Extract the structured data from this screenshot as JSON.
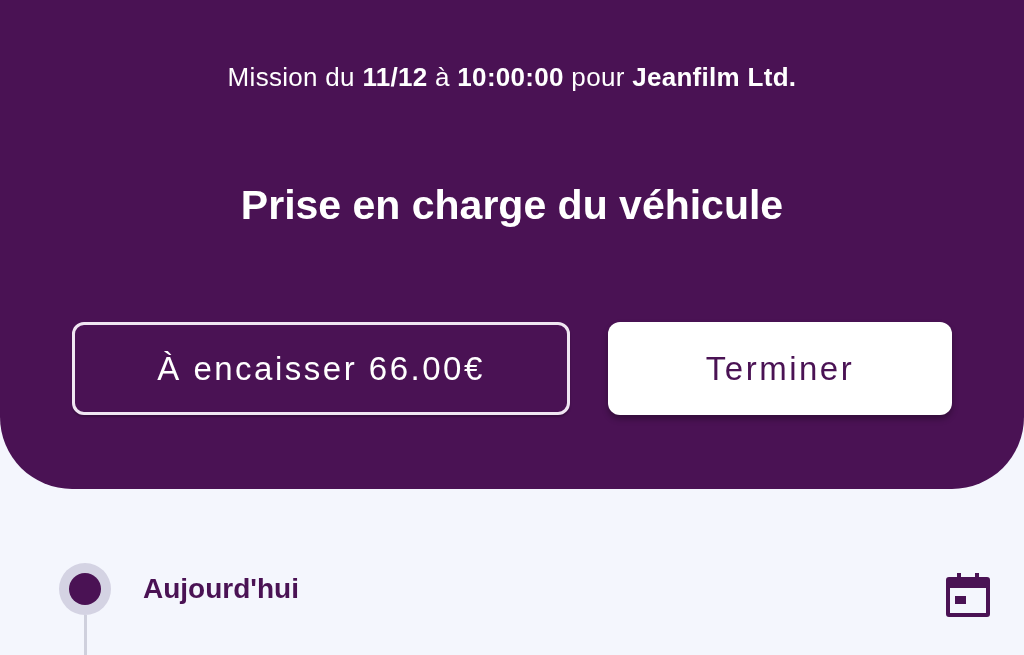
{
  "header": {
    "mission_line": "Mission du **11/12** à **10:00:00** pour **Jeanfilm Ltd.**",
    "title": "Prise en charge du véhicule",
    "buttons": [
      {
        "label": "À encaisser 66.00€",
        "kind": "outline"
      },
      {
        "label": "Terminer",
        "kind": "filled"
      }
    ]
  },
  "timeline": {
    "items": [
      {
        "label": "Aujourd'hui"
      }
    ]
  }
}
